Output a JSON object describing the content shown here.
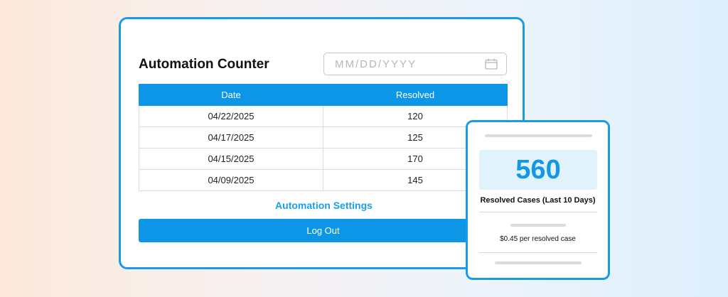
{
  "app": {
    "title": "Automation Counter"
  },
  "date_filter": {
    "placeholder": "MM/DD/YYYY",
    "icon": "calendar-icon"
  },
  "table": {
    "headers": [
      "Date",
      "Resolved"
    ],
    "rows": [
      [
        "04/22/2025",
        "120"
      ],
      [
        "04/17/2025",
        "125"
      ],
      [
        "04/15/2025",
        "170"
      ],
      [
        "04/09/2025",
        "145"
      ]
    ]
  },
  "actions": {
    "settings_label": "Automation Settings",
    "logout_label": "Log Out"
  },
  "stats": {
    "value": "560",
    "label": "Resolved Cases (Last 10 Days)",
    "price": "$0.45 per resolved case"
  },
  "colors": {
    "accent": "#0d96e6",
    "card_border": "#1a9be8",
    "stat_bg": "#e0f3fd"
  }
}
